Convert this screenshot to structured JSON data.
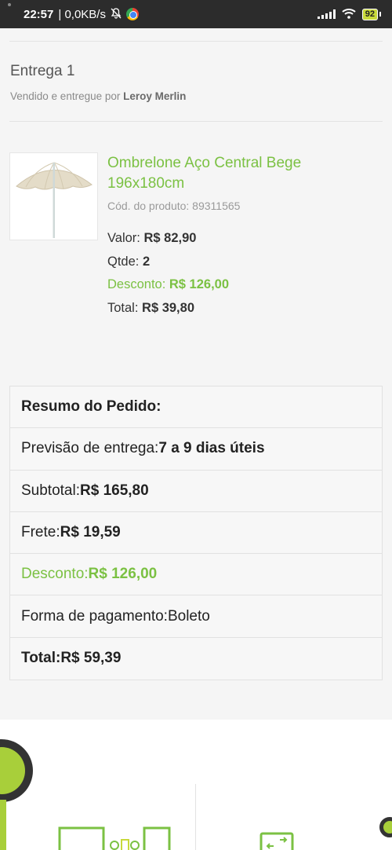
{
  "status_bar": {
    "time": "22:57",
    "speed": "| 0,0KB/s",
    "battery": "92"
  },
  "delivery": {
    "title": "Entrega 1",
    "seller_prefix": "Vendido e entregue por ",
    "seller_name": "Leroy Merlin"
  },
  "product": {
    "name": "Ombrelone Aço Central Bege 196x180cm",
    "code": "Cód. do produto: 89311565",
    "price_label": "Valor: ",
    "price": "R$ 82,90",
    "qty_label": "Qtde: ",
    "qty": "2",
    "discount_label": "Desconto: ",
    "discount": "R$ 126,00",
    "total_label": "Total: ",
    "total": "R$ 39,80"
  },
  "summary": {
    "title": "Resumo do Pedido:",
    "delivery_label": "Previsão de entrega: ",
    "delivery_value": "7 a 9 dias úteis",
    "subtotal_label": "Subtotal: ",
    "subtotal_value": "R$ 165,80",
    "shipping_label": "Frete: ",
    "shipping_value": "R$ 19,59",
    "discount_label": "Desconto: ",
    "discount_value": "R$ 126,00",
    "payment_label": "Forma de pagamento: ",
    "payment_value": "Boleto",
    "total_label": "Total: ",
    "total_value": "R$ 59,39"
  },
  "colors": {
    "accent_green": "#7bc143",
    "brand_lime": "#a8cf3a",
    "status_bar": "#2c2c2c"
  },
  "icons": [
    "mute-icon",
    "chrome-icon",
    "signal-icon",
    "wifi-icon",
    "battery-icon",
    "umbrella-image",
    "store-illustration",
    "delivery-box-icon"
  ]
}
